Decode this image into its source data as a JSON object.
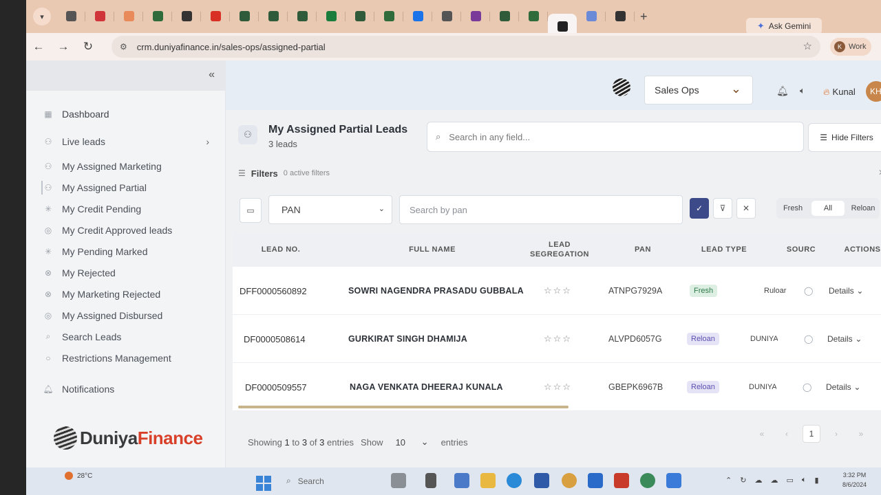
{
  "browser": {
    "url": "crm.duniyafinance.in/sales-ops/assigned-partial",
    "ask_gemini": "Ask Gemini",
    "profile_label": "Work",
    "profile_initial": "K",
    "tab_colors": [
      "#555555",
      "#d0353a",
      "#e88a5a",
      "#2f6b3b",
      "#333333",
      "#d93025",
      "#2f5b3a",
      "#2f5b3a",
      "#2f5b3a",
      "#1b7d3b",
      "#2f5b3a",
      "#2f6b3b",
      "#1a73e8",
      "#555555",
      "#7a3a9a",
      "#2f5b3a",
      "#2f6b3b",
      "#222222",
      "#6a8ad8",
      "#333333"
    ]
  },
  "sidebar": {
    "items": [
      {
        "label": "Dashboard",
        "icon": "grid-icon"
      },
      {
        "label": "Live leads",
        "icon": "users-icon"
      },
      {
        "label": "My Assigned Marketing",
        "icon": "user-icon"
      },
      {
        "label": "My Assigned Partial",
        "icon": "users-icon"
      },
      {
        "label": "My Credit Pending",
        "icon": "loader-icon"
      },
      {
        "label": "My Credit Approved leads",
        "icon": "check-circle-icon"
      },
      {
        "label": "My Pending Marked",
        "icon": "loader-icon"
      },
      {
        "label": "My Rejected",
        "icon": "x-circle-icon"
      },
      {
        "label": "My Marketing Rejected",
        "icon": "x-circle-icon"
      },
      {
        "label": "My Assigned Disbursed",
        "icon": "check-circle-icon"
      },
      {
        "label": "Search Leads",
        "icon": "search-icon"
      },
      {
        "label": "Restrictions Management",
        "icon": "circle-icon"
      },
      {
        "label": "Notifications",
        "icon": "bell-icon"
      }
    ],
    "brand_a": "Duniya",
    "brand_b": "Finance"
  },
  "topbar": {
    "role": "Sales Ops",
    "user_name": "Kunal",
    "user_initials": "KH"
  },
  "page": {
    "title": "My Assigned Partial Leads",
    "count": "3 leads",
    "search_placeholder": "Search in any field...",
    "hide_filters": "Hide Filters",
    "filters_label": "Filters",
    "active_filters": "0 active filters",
    "filter_field": "PAN",
    "filter_placeholder": "Search by pan",
    "segments": [
      "Fresh",
      "All",
      "Reloan"
    ]
  },
  "table": {
    "headers": {
      "lead_no": "LEAD NO.",
      "full_name": "FULL NAME",
      "segregation_1": "LEAD",
      "segregation_2": "SEGREGATION",
      "pan": "PAN",
      "lead_type": "LEAD TYPE",
      "source": "SOURC",
      "actions": "ACTIONS"
    },
    "rows": [
      {
        "lead_no": "DFF0000560892",
        "name": "SOWRI NAGENDRA PRASADU GUBBALA",
        "stars": "☆☆☆",
        "pan": "ATNPG7929A",
        "type": "Fresh",
        "source": "Ruloar",
        "action": "Details"
      },
      {
        "lead_no": "DF0000508614",
        "name": "GURKIRAT SINGH DHAMIJA",
        "stars": "☆☆☆",
        "pan": "ALVPD6057G",
        "type": "Reloan",
        "source": "DUNIYA_\\",
        "action": "Details"
      },
      {
        "lead_no": "DF0000509557",
        "name": "NAGA VENKATA DHEERAJ KUNALA",
        "stars": "☆☆☆",
        "pan": "GBEPK6967B",
        "type": "Reloan",
        "source": "DUNIYA_\\",
        "action": "Details"
      }
    ]
  },
  "footer": {
    "showing": "Showing",
    "from": "1",
    "to_word": "to",
    "to": "3",
    "of_word": "of",
    "total": "3",
    "entries_word": "entries",
    "show_label": "Show",
    "page_size": "10",
    "entries_label": "entries",
    "current_page": "1"
  },
  "taskbar": {
    "temperature": "28°C",
    "search": "Search",
    "time": "3:32 PM",
    "date": "8/6/2024"
  }
}
